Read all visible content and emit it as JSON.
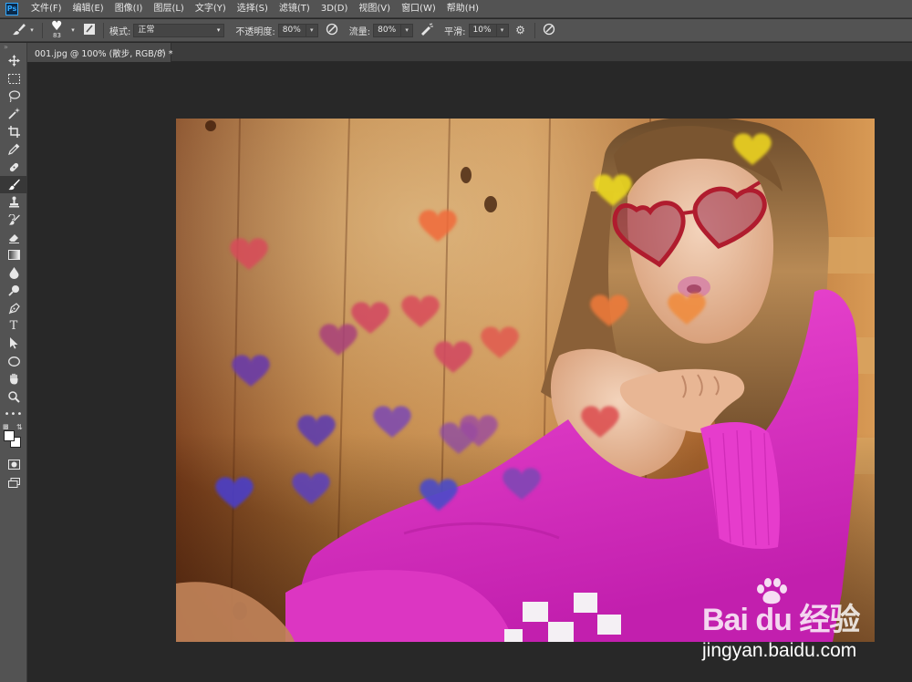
{
  "app": {
    "logo_text": "Ps",
    "menu": [
      "文件(F)",
      "编辑(E)",
      "图像(I)",
      "图层(L)",
      "文字(Y)",
      "选择(S)",
      "滤镜(T)",
      "3D(D)",
      "视图(V)",
      "窗口(W)",
      "帮助(H)"
    ]
  },
  "options": {
    "brush_size": "83",
    "mode_label": "模式:",
    "mode_value": "正常",
    "opacity_label": "不透明度:",
    "opacity_value": "80%",
    "flow_label": "流量:",
    "flow_value": "80%",
    "smoothing_label": "平滑:",
    "smoothing_value": "10%"
  },
  "toolbar": {
    "tools": [
      "move-tool",
      "marquee-tool",
      "lasso-tool",
      "magic-wand-tool",
      "crop-tool",
      "eyedropper-tool",
      "healing-brush-tool",
      "brush-tool",
      "clone-stamp-tool",
      "history-brush-tool",
      "eraser-tool",
      "gradient-tool",
      "blur-tool",
      "dodge-tool",
      "pen-tool",
      "type-tool",
      "path-selection-tool",
      "ellipse-tool",
      "hand-tool",
      "zoom-tool",
      "more-tools"
    ],
    "active_tool": "brush-tool",
    "type_tool_glyph": "T",
    "foreground_color": "#ffffff",
    "background_color": "#ffffff"
  },
  "document": {
    "tab_title": "001.jpg @ 100% (散步, RGB/8) *",
    "close_glyph": "×"
  },
  "watermark": {
    "logo_text": "Bai du 经验",
    "url": "jingyan.baidu.com"
  },
  "colors": {
    "ui_panel": "#535353",
    "canvas_bg": "#282828",
    "sweater": "#e52fc9",
    "wood": "#b97a3a",
    "heart_red": "#d84a5a",
    "heart_orange": "#f07a3a",
    "heart_purple": "#7a48b4",
    "heart_blue": "#4a3ec8",
    "heart_yellow": "#f2da1c"
  }
}
